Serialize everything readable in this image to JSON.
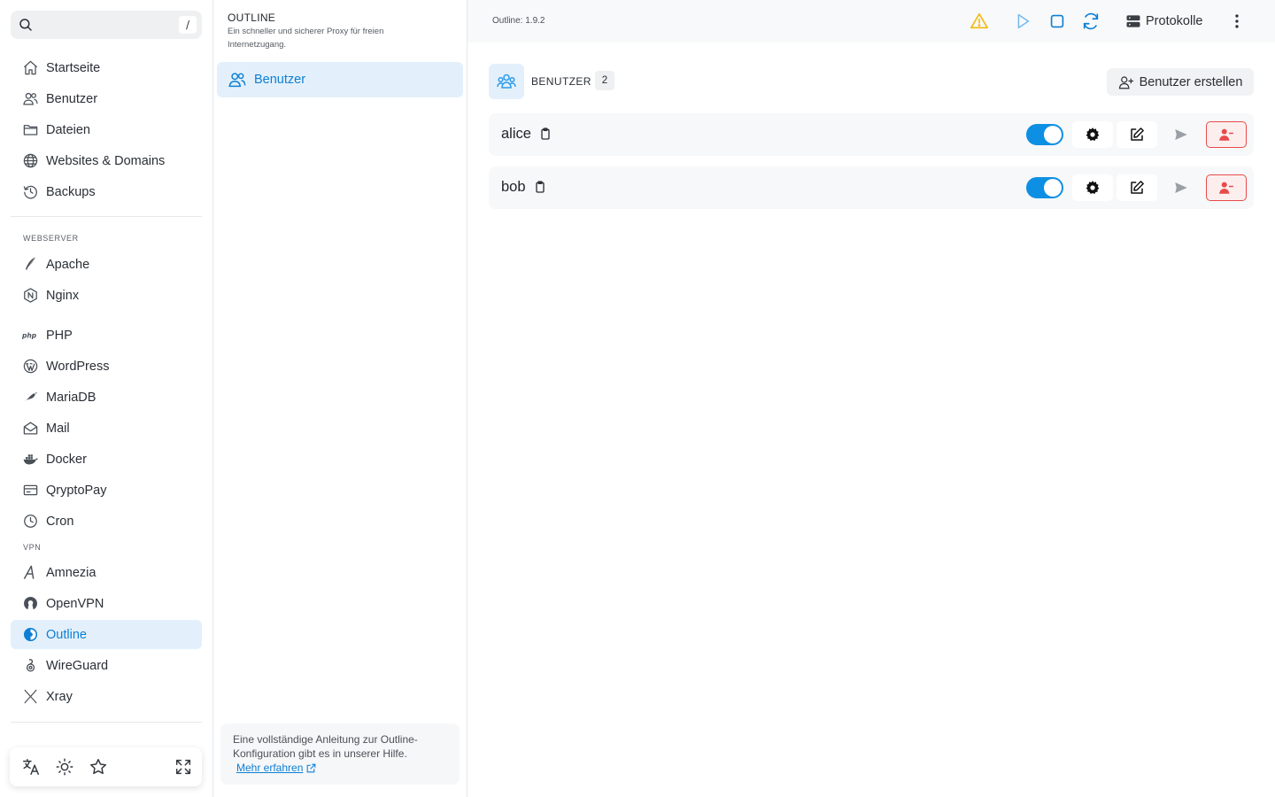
{
  "search": {
    "shortcut": "/"
  },
  "sidebar": {
    "items": [
      {
        "label": "Startseite",
        "icon": "home-icon"
      },
      {
        "label": "Benutzer",
        "icon": "users-icon"
      },
      {
        "label": "Dateien",
        "icon": "folder-icon"
      },
      {
        "label": "Websites & Domains",
        "icon": "globe-icon"
      },
      {
        "label": "Backups",
        "icon": "history-icon"
      }
    ],
    "section_webserver": "WEBSERVER",
    "webserver_items": [
      {
        "label": "Apache",
        "icon": "feather-icon"
      },
      {
        "label": "Nginx",
        "icon": "nginx-icon"
      }
    ],
    "app_items": [
      {
        "label": "PHP",
        "icon": "php-icon"
      },
      {
        "label": "WordPress",
        "icon": "wordpress-icon"
      },
      {
        "label": "MariaDB",
        "icon": "mariadb-icon"
      },
      {
        "label": "Mail",
        "icon": "mail-icon"
      },
      {
        "label": "Docker",
        "icon": "docker-icon"
      },
      {
        "label": "QryptoPay",
        "icon": "card-icon"
      },
      {
        "label": "Cron",
        "icon": "clock-icon"
      }
    ],
    "section_vpn": "VPN",
    "vpn_items": [
      {
        "label": "Amnezia",
        "icon": "amnezia-icon"
      },
      {
        "label": "OpenVPN",
        "icon": "openvpn-icon"
      },
      {
        "label": "Outline",
        "icon": "outline-icon",
        "active": true
      },
      {
        "label": "WireGuard",
        "icon": "wireguard-icon"
      },
      {
        "label": "Xray",
        "icon": "xray-icon"
      }
    ],
    "bottom_icons": [
      "translate-icon",
      "sun-icon",
      "star-icon",
      "expand-icon"
    ]
  },
  "panel": {
    "title": "OUTLINE",
    "subtitle": "Ein schneller und sicherer Proxy für freien Internetzugang.",
    "item": "Benutzer",
    "help_text": "Eine vollständige Anleitung zur Outline-Konfiguration gibt es in unserer Hilfe.",
    "help_link": "Mehr erfahren"
  },
  "topbar": {
    "version": "Outline: 1.9.2",
    "protokolle": "Protokolle"
  },
  "main": {
    "users_label": "BENUTZER",
    "users_count": "2",
    "create_button": "Benutzer erstellen",
    "users": [
      {
        "name": "alice",
        "enabled": true
      },
      {
        "name": "bob",
        "enabled": true
      }
    ]
  },
  "colors": {
    "accent": "#0d7fd4",
    "toggle_on": "#0d8fe3",
    "warning": "#f2b90c",
    "danger": "#e84a4a"
  }
}
